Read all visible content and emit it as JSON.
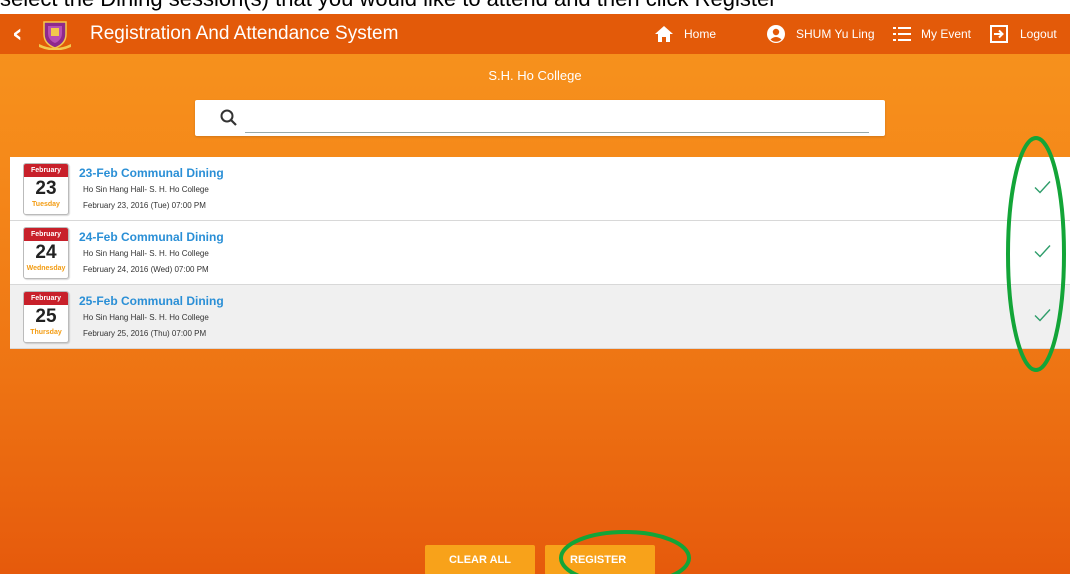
{
  "instruction_text": "select the Dining session(s) that you would like to attend and then click Register",
  "header": {
    "back_icon": "chevron-left-icon",
    "title": "Registration And Attendance System",
    "nav": {
      "home": "Home",
      "user": "SHUM Yu Ling",
      "my_event": "My Event",
      "logout": "Logout"
    }
  },
  "college": "S.H. Ho College",
  "search": {
    "value": "",
    "placeholder": ""
  },
  "events": [
    {
      "month": "February",
      "day": "23",
      "weekday": "Tuesday",
      "title": "23-Feb Communal Dining",
      "venue": "Ho Sin Hang Hall- S. H. Ho College",
      "datetime": "February 23, 2016 (Tue) 07:00 PM",
      "selected": true
    },
    {
      "month": "February",
      "day": "24",
      "weekday": "Wednesday",
      "title": "24-Feb Communal Dining",
      "venue": "Ho Sin Hang Hall- S. H. Ho College",
      "datetime": "February 24, 2016 (Wed) 07:00 PM",
      "selected": true
    },
    {
      "month": "February",
      "day": "25",
      "weekday": "Thursday",
      "title": "25-Feb Communal Dining",
      "venue": "Ho Sin Hang Hall- S. H. Ho College",
      "datetime": "February 25, 2016 (Thu) 07:00 PM",
      "selected": true
    }
  ],
  "buttons": {
    "clear_all": "CLEAR ALL",
    "register": "REGISTER"
  },
  "colors": {
    "topbar": "#e35a09",
    "accent": "#f7941d",
    "check": "#2e9d6a",
    "annotation": "#13a538",
    "title_link": "#2a8fd6",
    "calendar_month": "#c8202a"
  }
}
